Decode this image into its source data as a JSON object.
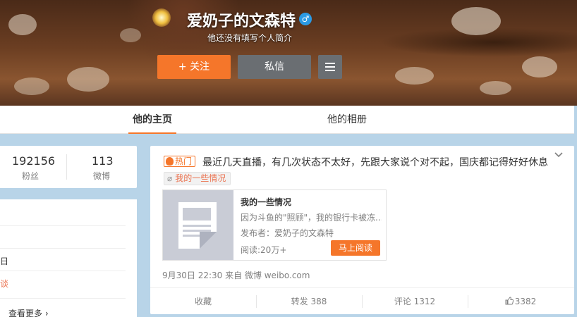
{
  "profile": {
    "nickname": "爱奶子的文森特",
    "gender_symbol": "♂",
    "intro": "他还没有填写个人简介"
  },
  "buttons": {
    "follow": "+ 关注",
    "message": "私信"
  },
  "tabs": [
    {
      "label": "他的主页",
      "active": true
    },
    {
      "label": "他的相册",
      "active": false
    }
  ],
  "stats": {
    "fans_count": "192156",
    "fans_label": "粉丝",
    "weibo_count": "113",
    "weibo_label": "微博"
  },
  "info": {
    "line_ri": "日",
    "line_tan": "谈",
    "more": "查看更多 ›"
  },
  "post": {
    "hot_label": "热门",
    "text": "最近几天直播，有几次状态不太好，先跟大家说个对不起，国庆都记得好好休息",
    "topic": "我的一些情况",
    "article": {
      "title": "我的一些情况",
      "desc": "因为斗鱼的\"照顾\"，我的银行卡被冻...",
      "publisher": "发布者：爱奶子的文森特",
      "reads": "阅读:20万+",
      "read_button": "马上阅读"
    },
    "meta": "9月30日 22:30 来自 微博 weibo.com",
    "actions": {
      "collect": "收藏",
      "repost": "转发 388",
      "comment": "评论 1312",
      "like": "3382"
    }
  },
  "colors": {
    "accent": "#f5762a",
    "gray_button": "#6a6e72",
    "page_bg": "#b8d4e8"
  }
}
